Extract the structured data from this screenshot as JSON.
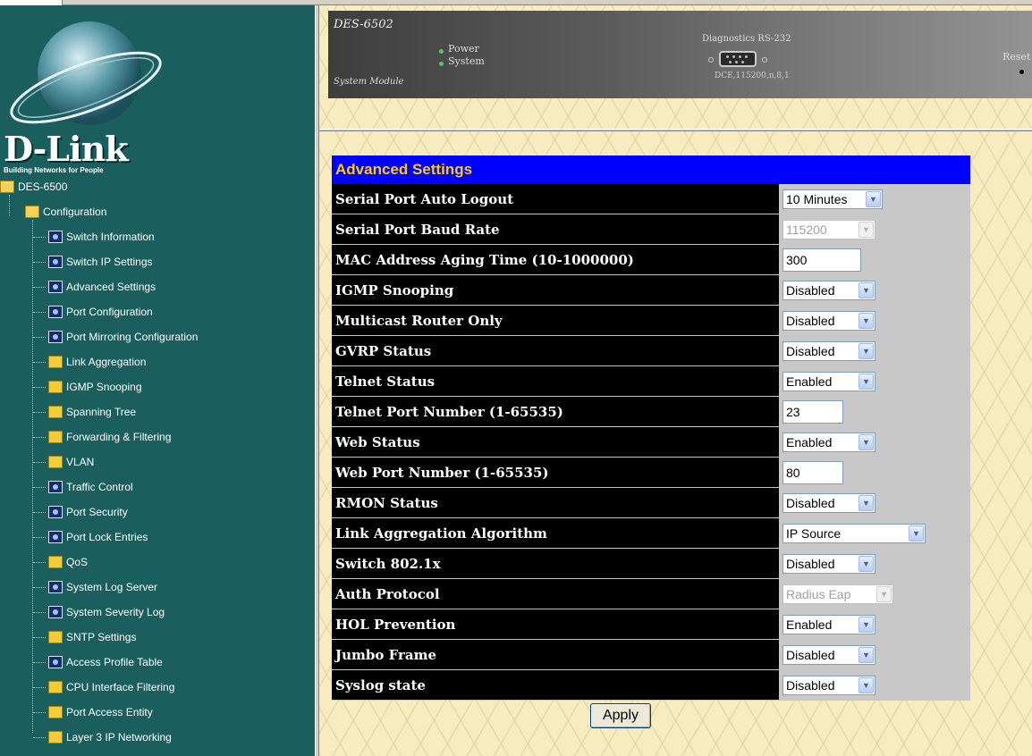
{
  "brand": {
    "logo": "D-Link",
    "tagline": "Building Networks for People"
  },
  "device": {
    "model": "DES-6502",
    "module": "System Module",
    "leds": [
      "Power",
      "System"
    ],
    "diag_title": "Diagnostics RS-232",
    "diag_params": "DCE,115200,n,8,1",
    "reset_label": "Reset"
  },
  "nav": {
    "root": "DES-6500",
    "config": "Configuration",
    "items": [
      {
        "label": "Switch Information",
        "icon": "doc-icon"
      },
      {
        "label": "Switch IP Settings",
        "icon": "doc-icon"
      },
      {
        "label": "Advanced Settings",
        "icon": "doc-icon"
      },
      {
        "label": "Port Configuration",
        "icon": "doc-icon"
      },
      {
        "label": "Port Mirroring Configuration",
        "icon": "doc-icon"
      },
      {
        "label": "Link Aggregation",
        "icon": "folder-icon"
      },
      {
        "label": "IGMP Snooping",
        "icon": "folder-icon"
      },
      {
        "label": "Spanning Tree",
        "icon": "folder-icon"
      },
      {
        "label": "Forwarding & Filtering",
        "icon": "folder-icon"
      },
      {
        "label": "VLAN",
        "icon": "folder-icon"
      },
      {
        "label": "Traffic Control",
        "icon": "doc-icon"
      },
      {
        "label": "Port Security",
        "icon": "doc-icon"
      },
      {
        "label": "Port Lock Entries",
        "icon": "doc-icon"
      },
      {
        "label": "QoS",
        "icon": "folder-icon"
      },
      {
        "label": "System Log Server",
        "icon": "doc-icon"
      },
      {
        "label": "System Severity Log",
        "icon": "doc-icon"
      },
      {
        "label": "SNTP Settings",
        "icon": "folder-icon"
      },
      {
        "label": "Access Profile Table",
        "icon": "doc-icon"
      },
      {
        "label": "CPU Interface Filtering",
        "icon": "folder-icon"
      },
      {
        "label": "Port Access Entity",
        "icon": "folder-icon"
      },
      {
        "label": "Layer 3 IP Networking",
        "icon": "folder-icon"
      }
    ]
  },
  "settings": {
    "title": "Advanced Settings",
    "rows": [
      {
        "label": "Serial Port Auto Logout",
        "type": "select",
        "value": "10 Minutes",
        "disabled": false
      },
      {
        "label": "Serial Port Baud Rate",
        "type": "select",
        "value": "115200",
        "disabled": true
      },
      {
        "label": "MAC Address Aging Time (10-1000000)",
        "type": "text",
        "value": "300",
        "disabled": false
      },
      {
        "label": "IGMP Snooping",
        "type": "select",
        "value": "Disabled",
        "disabled": false
      },
      {
        "label": "Multicast Router Only",
        "type": "select",
        "value": "Disabled",
        "disabled": false
      },
      {
        "label": "GVRP Status",
        "type": "select",
        "value": "Disabled",
        "disabled": false
      },
      {
        "label": "Telnet Status",
        "type": "select",
        "value": "Enabled",
        "disabled": false
      },
      {
        "label": "Telnet Port Number (1-65535)",
        "type": "text",
        "value": "23",
        "disabled": false
      },
      {
        "label": "Web Status",
        "type": "select",
        "value": "Enabled",
        "disabled": false
      },
      {
        "label": "Web Port Number (1-65535)",
        "type": "text",
        "value": "80",
        "disabled": false
      },
      {
        "label": "RMON Status",
        "type": "select",
        "value": "Disabled",
        "disabled": false
      },
      {
        "label": "Link Aggregation Algorithm",
        "type": "select",
        "value": "IP Source",
        "disabled": false
      },
      {
        "label": "Switch 802.1x",
        "type": "select",
        "value": "Disabled",
        "disabled": false
      },
      {
        "label": "Auth Protocol",
        "type": "select",
        "value": "Radius Eap",
        "disabled": true
      },
      {
        "label": "HOL Prevention",
        "type": "select",
        "value": "Enabled",
        "disabled": false
      },
      {
        "label": "Jumbo Frame",
        "type": "select",
        "value": "Disabled",
        "disabled": false
      },
      {
        "label": "Syslog state",
        "type": "select",
        "value": "Disabled",
        "disabled": false
      }
    ],
    "apply_label": "Apply"
  },
  "colors": {
    "nav_bg": "#1b5e5e",
    "title_bg": "#0000ff",
    "title_fg": "#ffcc00",
    "label_bg": "#000000",
    "control_bg": "#c8c8c8"
  }
}
